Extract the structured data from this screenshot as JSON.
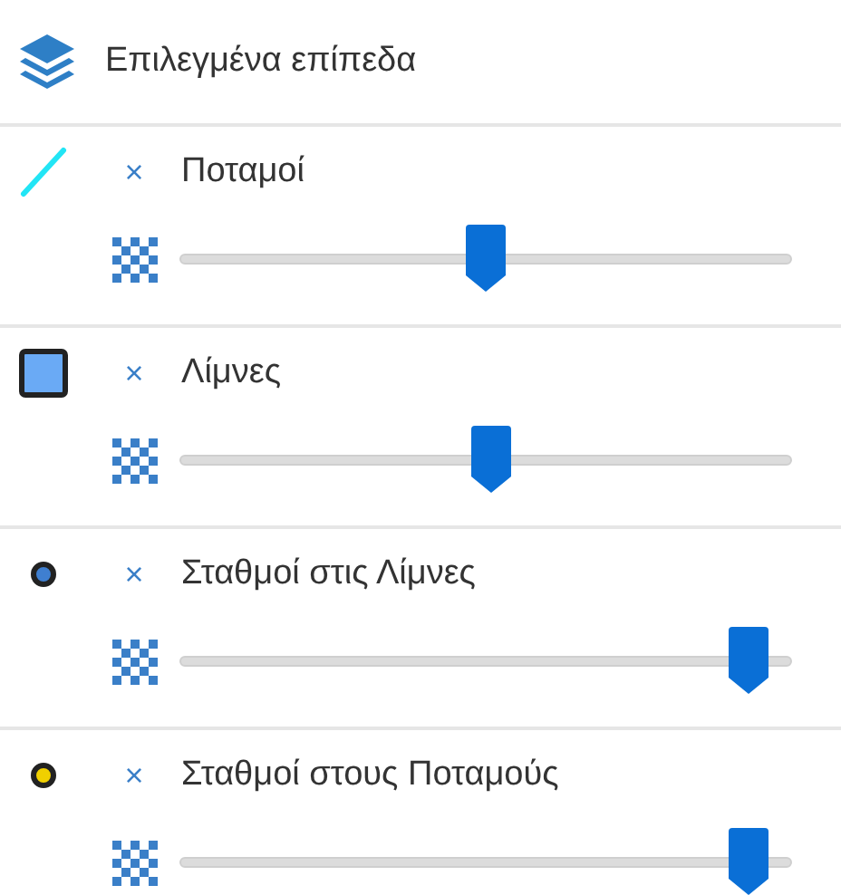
{
  "title": "Επιλεγμένα επίπεδα",
  "layers": [
    {
      "name": "Ποταμοί",
      "remove": "×",
      "kind": "line",
      "color": "#22e5f5",
      "level": 0.5
    },
    {
      "name": "Λίμνες",
      "remove": "×",
      "kind": "polygon",
      "color": "#6aaaf5",
      "level": 0.51
    },
    {
      "name": "Σταθμοί στις Λίμνες",
      "remove": "×",
      "kind": "point",
      "color": "#3f7fd0",
      "level": 0.96
    },
    {
      "name": "Σταθμοί στους Ποταμούς",
      "remove": "×",
      "kind": "point",
      "color": "#f0d000",
      "level": 0.96
    }
  ]
}
